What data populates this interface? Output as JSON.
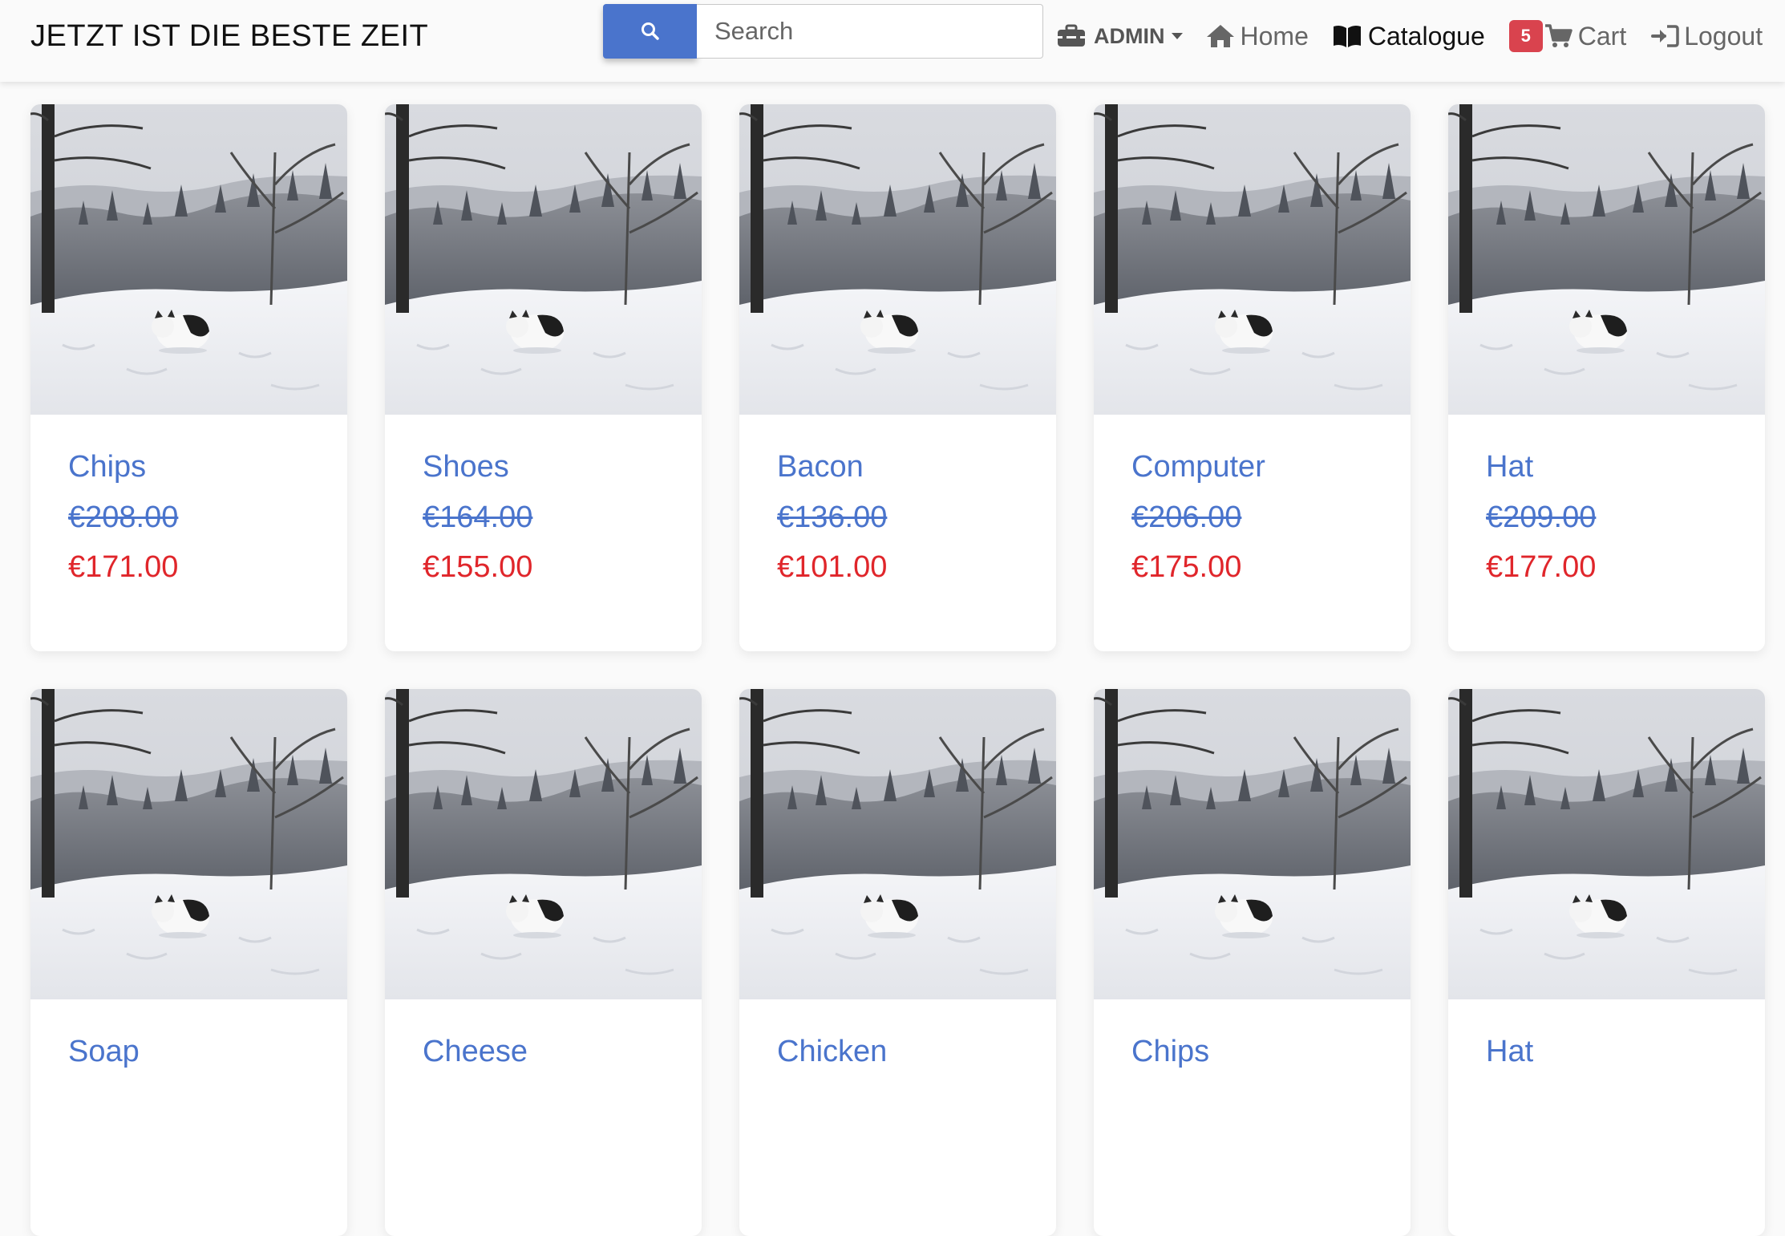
{
  "brand": "JETZT IST DIE BESTE ZEIT",
  "search": {
    "placeholder": "Search",
    "value": "",
    "icon": "search-icon"
  },
  "nav": {
    "admin": "ADMIN",
    "home": "Home",
    "catalogue": "Catalogue",
    "cart_count": "5",
    "cart": "Cart",
    "logout": "Logout"
  },
  "colors": {
    "accent": "#4a74cc",
    "sale_price": "#e0262b",
    "badge": "#d9434e"
  },
  "products": [
    {
      "name": "Chips",
      "old_price": "€208.00",
      "price": "€171.00"
    },
    {
      "name": "Shoes",
      "old_price": "€164.00",
      "price": "€155.00"
    },
    {
      "name": "Bacon",
      "old_price": "€136.00",
      "price": "€101.00"
    },
    {
      "name": "Computer",
      "old_price": "€206.00",
      "price": "€175.00"
    },
    {
      "name": "Hat",
      "old_price": "€209.00",
      "price": "€177.00"
    },
    {
      "name": "Soap",
      "old_price": "",
      "price": ""
    },
    {
      "name": "Cheese",
      "old_price": "",
      "price": ""
    },
    {
      "name": "Chicken",
      "old_price": "",
      "price": ""
    },
    {
      "name": "Chips",
      "old_price": "",
      "price": ""
    },
    {
      "name": "Hat",
      "old_price": "",
      "price": ""
    }
  ]
}
